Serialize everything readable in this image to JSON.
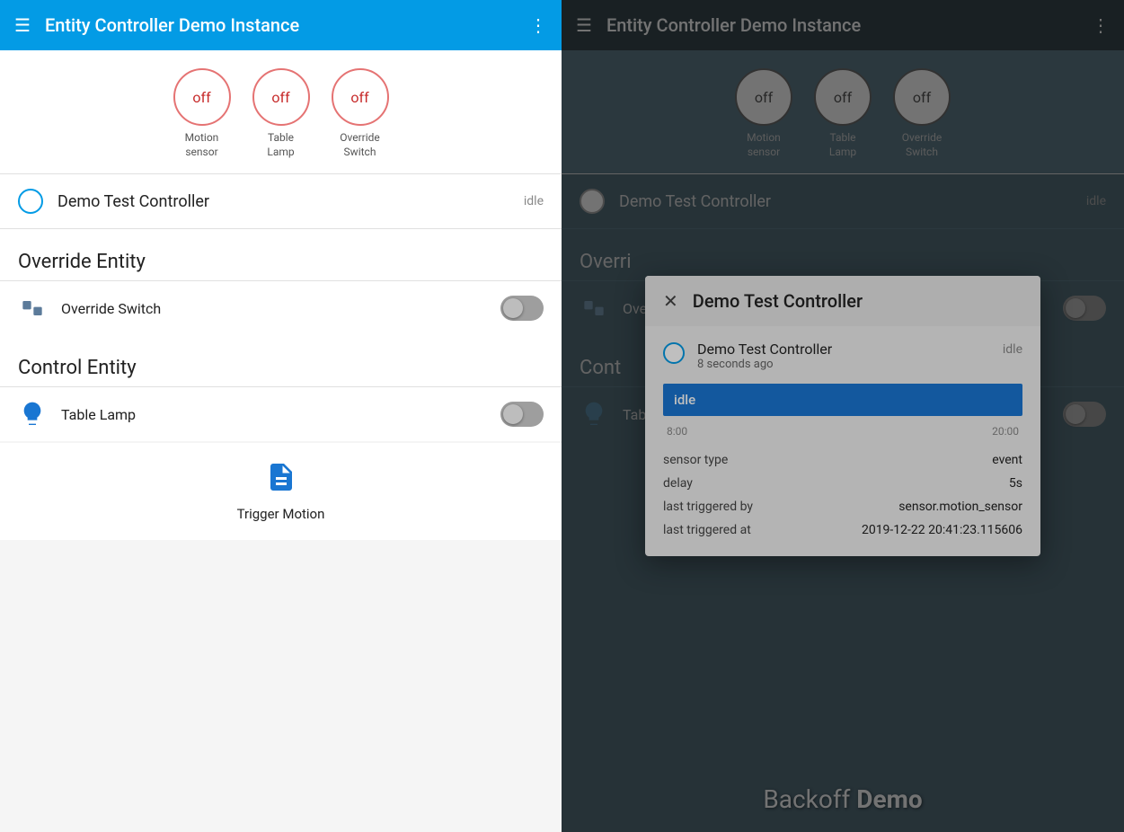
{
  "left": {
    "topbar": {
      "title": "Entity Controller Demo Instance"
    },
    "circles": [
      {
        "label_line1": "Motion",
        "label_line2": "sensor",
        "value": "off"
      },
      {
        "label_line1": "Table",
        "label_line2": "Lamp",
        "value": "off"
      },
      {
        "label_line1": "Override",
        "label_line2": "Switch",
        "value": "off"
      }
    ],
    "controller": {
      "name": "Demo Test Controller",
      "status": "idle"
    },
    "override_section": {
      "heading": "Override Entity",
      "item": "Override Switch"
    },
    "control_section": {
      "heading": "Control Entity",
      "item": "Table Lamp"
    },
    "trigger": {
      "label": "Trigger Motion"
    },
    "bottom_text": "Backoff Demo"
  },
  "right": {
    "topbar": {
      "title": "Entity Controller Demo Instance"
    },
    "circles": [
      {
        "label_line1": "Motion",
        "label_line2": "sensor",
        "value": "off"
      },
      {
        "label_line1": "Table",
        "label_line2": "Lamp",
        "value": "off"
      },
      {
        "label_line1": "Override",
        "label_line2": "Switch",
        "value": "off"
      }
    ],
    "controller": {
      "name": "Demo Test Controller",
      "status": "idle"
    },
    "override_section": {
      "heading": "Overri",
      "item": "Override Switch"
    },
    "control_section": {
      "heading": "Cont",
      "item": "Table Lamp"
    },
    "trigger": {
      "label": "Trigger Motion"
    }
  },
  "dialog": {
    "title": "Demo Test Controller",
    "close_label": "✕",
    "controller_name": "Demo Test Controller",
    "controller_time": "8 seconds ago",
    "controller_status": "idle",
    "state_label": "idle",
    "timeline_start": "8:00",
    "timeline_end": "20:00",
    "info_rows": [
      {
        "key": "sensor type",
        "value": "event"
      },
      {
        "key": "delay",
        "value": "5s"
      },
      {
        "key": "last triggered by",
        "value": "sensor.motion_sensor"
      },
      {
        "key": "last triggered at",
        "value": "2019-12-22 20:41:23.115606"
      }
    ]
  },
  "icons": {
    "hamburger": "☰",
    "more": "⋮",
    "switch_unicode": "⧉",
    "bulb_unicode": "💡",
    "trigger_unicode": "📄"
  }
}
